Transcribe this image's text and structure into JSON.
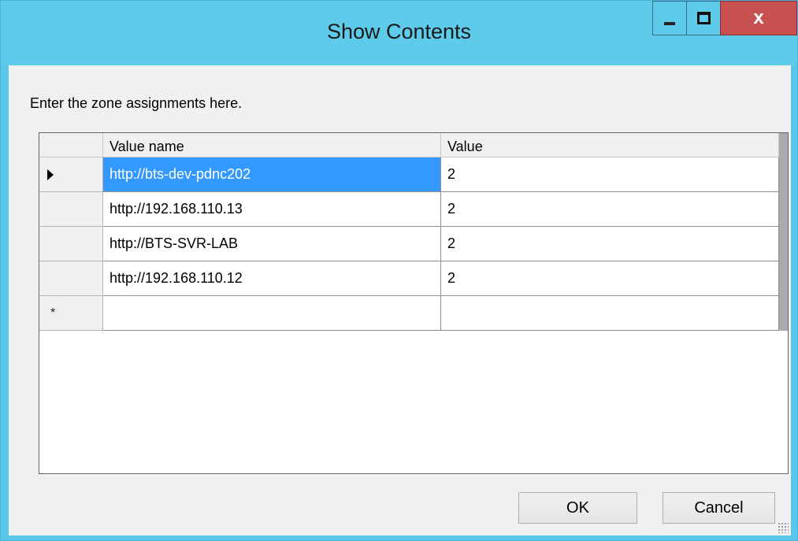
{
  "window": {
    "title": "Show Contents",
    "close_symbol": "x",
    "colors": {
      "titlebar": "#5fcbea",
      "close_button": "#c75050",
      "selection": "#3399ff"
    }
  },
  "instruction": "Enter the zone assignments here.",
  "grid": {
    "columns": [
      "Value name",
      "Value"
    ],
    "rows": [
      {
        "name": "http://bts-dev-pdnc202",
        "value": "2",
        "selected": true,
        "current": true
      },
      {
        "name": "http://192.168.110.13",
        "value": "2"
      },
      {
        "name": "http://BTS-SVR-LAB",
        "value": "2"
      },
      {
        "name": "http://192.168.110.12",
        "value": "2"
      }
    ],
    "new_row_marker": "*"
  },
  "buttons": {
    "ok": "OK",
    "cancel": "Cancel"
  },
  "icons": [
    "minimize-icon",
    "maximize-icon",
    "close-icon",
    "current-row-arrow-icon",
    "new-row-icon",
    "resize-grip-icon"
  ]
}
